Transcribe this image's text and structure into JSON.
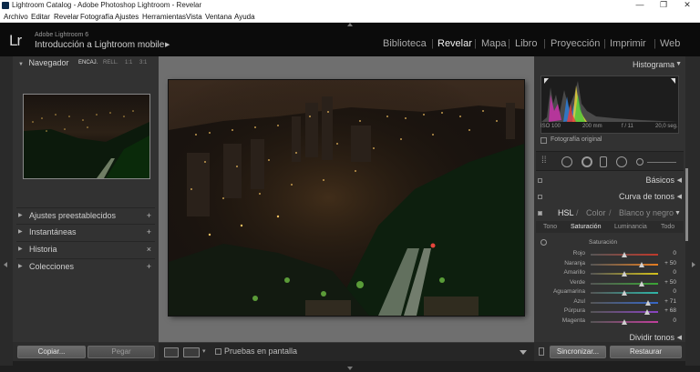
{
  "window": {
    "title": "Lightroom Catalog - Adobe Photoshop Lightroom - Revelar",
    "controls": [
      "—",
      "❐",
      "✕"
    ]
  },
  "menu": [
    "Archivo",
    "Editar",
    "Revelar",
    "Fotografía",
    "Ajustes",
    "Herramientas",
    "Vista",
    "Ventana",
    "Ayuda"
  ],
  "identity": {
    "logo": "Lr",
    "product": "Adobe Lightroom 6",
    "catalog": "Introducción a Lightroom mobile"
  },
  "modules": [
    {
      "label": "Biblioteca",
      "active": false
    },
    {
      "label": "Revelar",
      "active": true
    },
    {
      "label": "Mapa",
      "active": false
    },
    {
      "label": "Libro",
      "active": false
    },
    {
      "label": "Proyección",
      "active": false
    },
    {
      "label": "Imprimir",
      "active": false
    },
    {
      "label": "Web",
      "active": false
    }
  ],
  "left": {
    "navigator": {
      "title": "Navegador",
      "options": [
        "ENCAJ.",
        "RELL.",
        "1:1",
        "3:1"
      ]
    },
    "sections": [
      {
        "label": "Ajustes preestablecidos",
        "action": "+"
      },
      {
        "label": "Instantáneas",
        "action": "+"
      },
      {
        "label": "Historia",
        "action": "×"
      },
      {
        "label": "Colecciones",
        "action": "+"
      }
    ],
    "copy_button": "Copiar...",
    "paste_button": "Pegar"
  },
  "toolbar": {
    "soft_proof_label": "Pruebas en pantalla"
  },
  "right": {
    "histogram": {
      "title": "Histograma",
      "iso": "ISO 100",
      "focal": "200 mm",
      "aperture": "f / 11",
      "shutter": "20,0 seg.",
      "original_photo": "Fotografía original"
    },
    "basic": "Básicos",
    "tone_curve": "Curva de tonos",
    "hsl_tabs": [
      "HSL",
      "/",
      "Color",
      "/",
      "Blanco y negro"
    ],
    "sub_tabs": [
      "Tono",
      "Saturación",
      "Luminancia",
      "Todo"
    ],
    "saturation_title": "Saturación",
    "sliders": [
      {
        "name": "Rojo",
        "value": "0",
        "pos": 0.5,
        "color": "#c0392b"
      },
      {
        "name": "Naranja",
        "value": "+ 50",
        "pos": 0.75,
        "color": "#e67e22"
      },
      {
        "name": "Amarillo",
        "value": "0",
        "pos": 0.5,
        "color": "#d4c21c"
      },
      {
        "name": "Verde",
        "value": "+ 50",
        "pos": 0.75,
        "color": "#3aa635"
      },
      {
        "name": "Aguamarina",
        "value": "0",
        "pos": 0.5,
        "color": "#2fb6a8"
      },
      {
        "name": "Azul",
        "value": "+ 71",
        "pos": 0.855,
        "color": "#3767c8"
      },
      {
        "name": "Púrpura",
        "value": "+ 68",
        "pos": 0.84,
        "color": "#8a44c2"
      },
      {
        "name": "Magenta",
        "value": "0",
        "pos": 0.5,
        "color": "#c23f9c"
      }
    ],
    "split_toning": "Dividir tonos",
    "sync_button": "Sincronizar...",
    "reset_button": "Restaurar"
  }
}
